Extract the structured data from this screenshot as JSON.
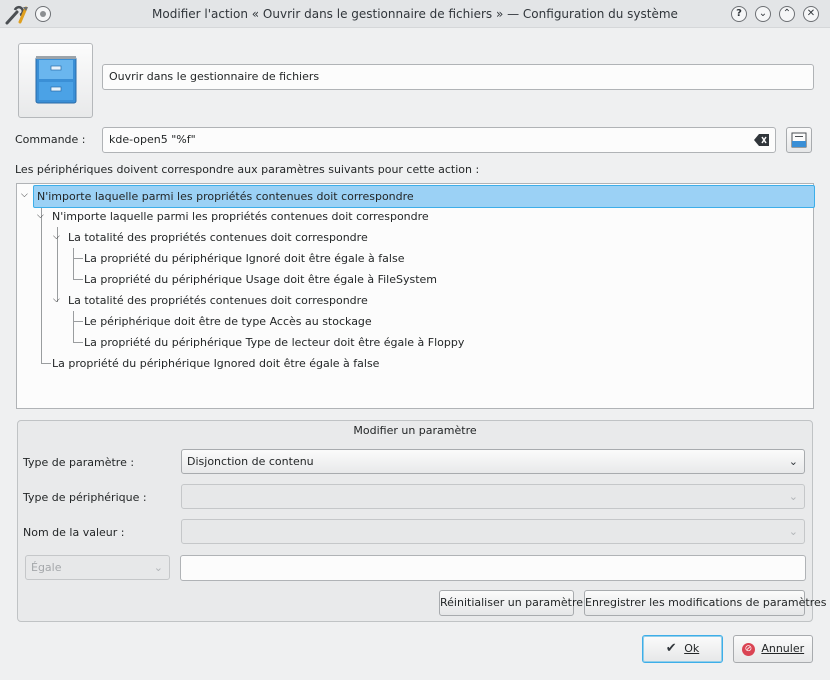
{
  "window": {
    "title": "Modifier l'action « Ouvrir dans le gestionnaire de fichiers » — Configuration du système"
  },
  "action": {
    "name_value": "Ouvrir dans le gestionnaire de fichiers",
    "command_label": "Commande :",
    "command_value": "kde-open5 \"%f\""
  },
  "tree": {
    "header_label": "Les périphériques doivent correspondre aux paramètres suivants pour cette action :",
    "rows": [
      "N'importe laquelle parmi les propriétés contenues doit correspondre",
      "N'importe laquelle parmi les propriétés contenues doit correspondre",
      "La totalité des propriétés contenues doit correspondre",
      "La propriété du périphérique Ignoré doit être égale à false",
      "La propriété du périphérique Usage doit être égale à FileSystem",
      "La totalité des propriétés contenues doit correspondre",
      "Le périphérique doit être de type Accès au stockage",
      "La propriété du périphérique Type de lecteur doit être égale à Floppy",
      "La propriété du périphérique Ignored doit être égale à false"
    ]
  },
  "edit_param": {
    "group_title": "Modifier un paramètre",
    "param_type_label": "Type de paramètre :",
    "param_type_value": "Disjonction de contenu",
    "device_type_label": "Type de périphérique :",
    "device_type_value": "",
    "value_name_label": "Nom de la valeur :",
    "value_name_value": "",
    "comparison_value": "Égale",
    "value_input": "",
    "reset_button": "Réinitialiser un paramètre",
    "save_button": "Enregistrer les modifications de paramètres"
  },
  "footer": {
    "ok_button": "Ok",
    "cancel_button": "Annuler"
  },
  "colors": {
    "selection": "#9bd1f5",
    "selection_border": "#3daee9",
    "cancel_icon": "#da4453"
  }
}
